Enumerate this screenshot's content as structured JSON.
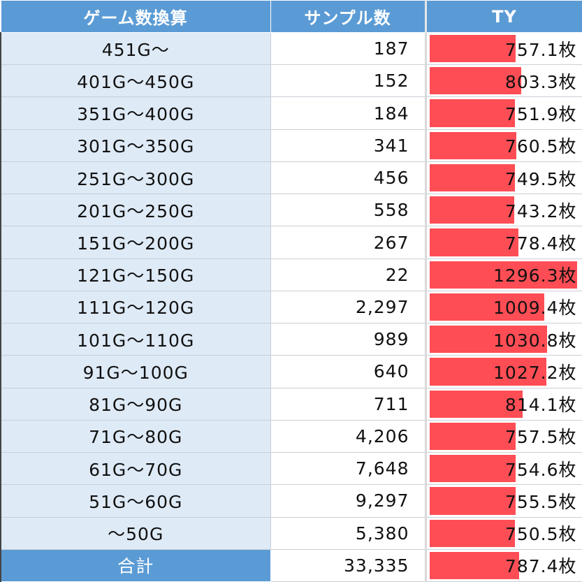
{
  "chart_data": {
    "type": "table",
    "columns": [
      "ゲーム数換算",
      "サンプル数",
      "TY"
    ],
    "rows": [
      {
        "range": "451G〜",
        "samples": "187",
        "ty": 757.1,
        "ty_label": "757.1枚"
      },
      {
        "range": "401G〜450G",
        "samples": "152",
        "ty": 803.3,
        "ty_label": "803.3枚"
      },
      {
        "range": "351G〜400G",
        "samples": "184",
        "ty": 751.9,
        "ty_label": "751.9枚"
      },
      {
        "range": "301G〜350G",
        "samples": "341",
        "ty": 760.5,
        "ty_label": "760.5枚"
      },
      {
        "range": "251G〜300G",
        "samples": "456",
        "ty": 749.5,
        "ty_label": "749.5枚"
      },
      {
        "range": "201G〜250G",
        "samples": "558",
        "ty": 743.2,
        "ty_label": "743.2枚"
      },
      {
        "range": "151G〜200G",
        "samples": "267",
        "ty": 778.4,
        "ty_label": "778.4枚"
      },
      {
        "range": "121G〜150G",
        "samples": "22",
        "ty": 1296.3,
        "ty_label": "1296.3枚"
      },
      {
        "range": "111G〜120G",
        "samples": "2,297",
        "ty": 1009.4,
        "ty_label": "1009.4枚"
      },
      {
        "range": "101G〜110G",
        "samples": "989",
        "ty": 1030.8,
        "ty_label": "1030.8枚"
      },
      {
        "range": "91G〜100G",
        "samples": "640",
        "ty": 1027.2,
        "ty_label": "1027.2枚"
      },
      {
        "range": "81G〜90G",
        "samples": "711",
        "ty": 814.1,
        "ty_label": "814.1枚"
      },
      {
        "range": "71G〜80G",
        "samples": "4,206",
        "ty": 757.5,
        "ty_label": "757.5枚"
      },
      {
        "range": "61G〜70G",
        "samples": "7,648",
        "ty": 754.6,
        "ty_label": "754.6枚"
      },
      {
        "range": "51G〜60G",
        "samples": "9,297",
        "ty": 755.5,
        "ty_label": "755.5枚"
      },
      {
        "range": "〜50G",
        "samples": "5,380",
        "ty": 750.5,
        "ty_label": "750.5枚"
      }
    ],
    "total": {
      "range": "合計",
      "samples": "33,335",
      "ty": 787.4,
      "ty_label": "787.4枚"
    },
    "bar_max": 1296.3
  },
  "colors": {
    "header_bg": "#5b9bd5",
    "first_col_bg": "#deeaf6",
    "bar": "#ff4d55"
  }
}
